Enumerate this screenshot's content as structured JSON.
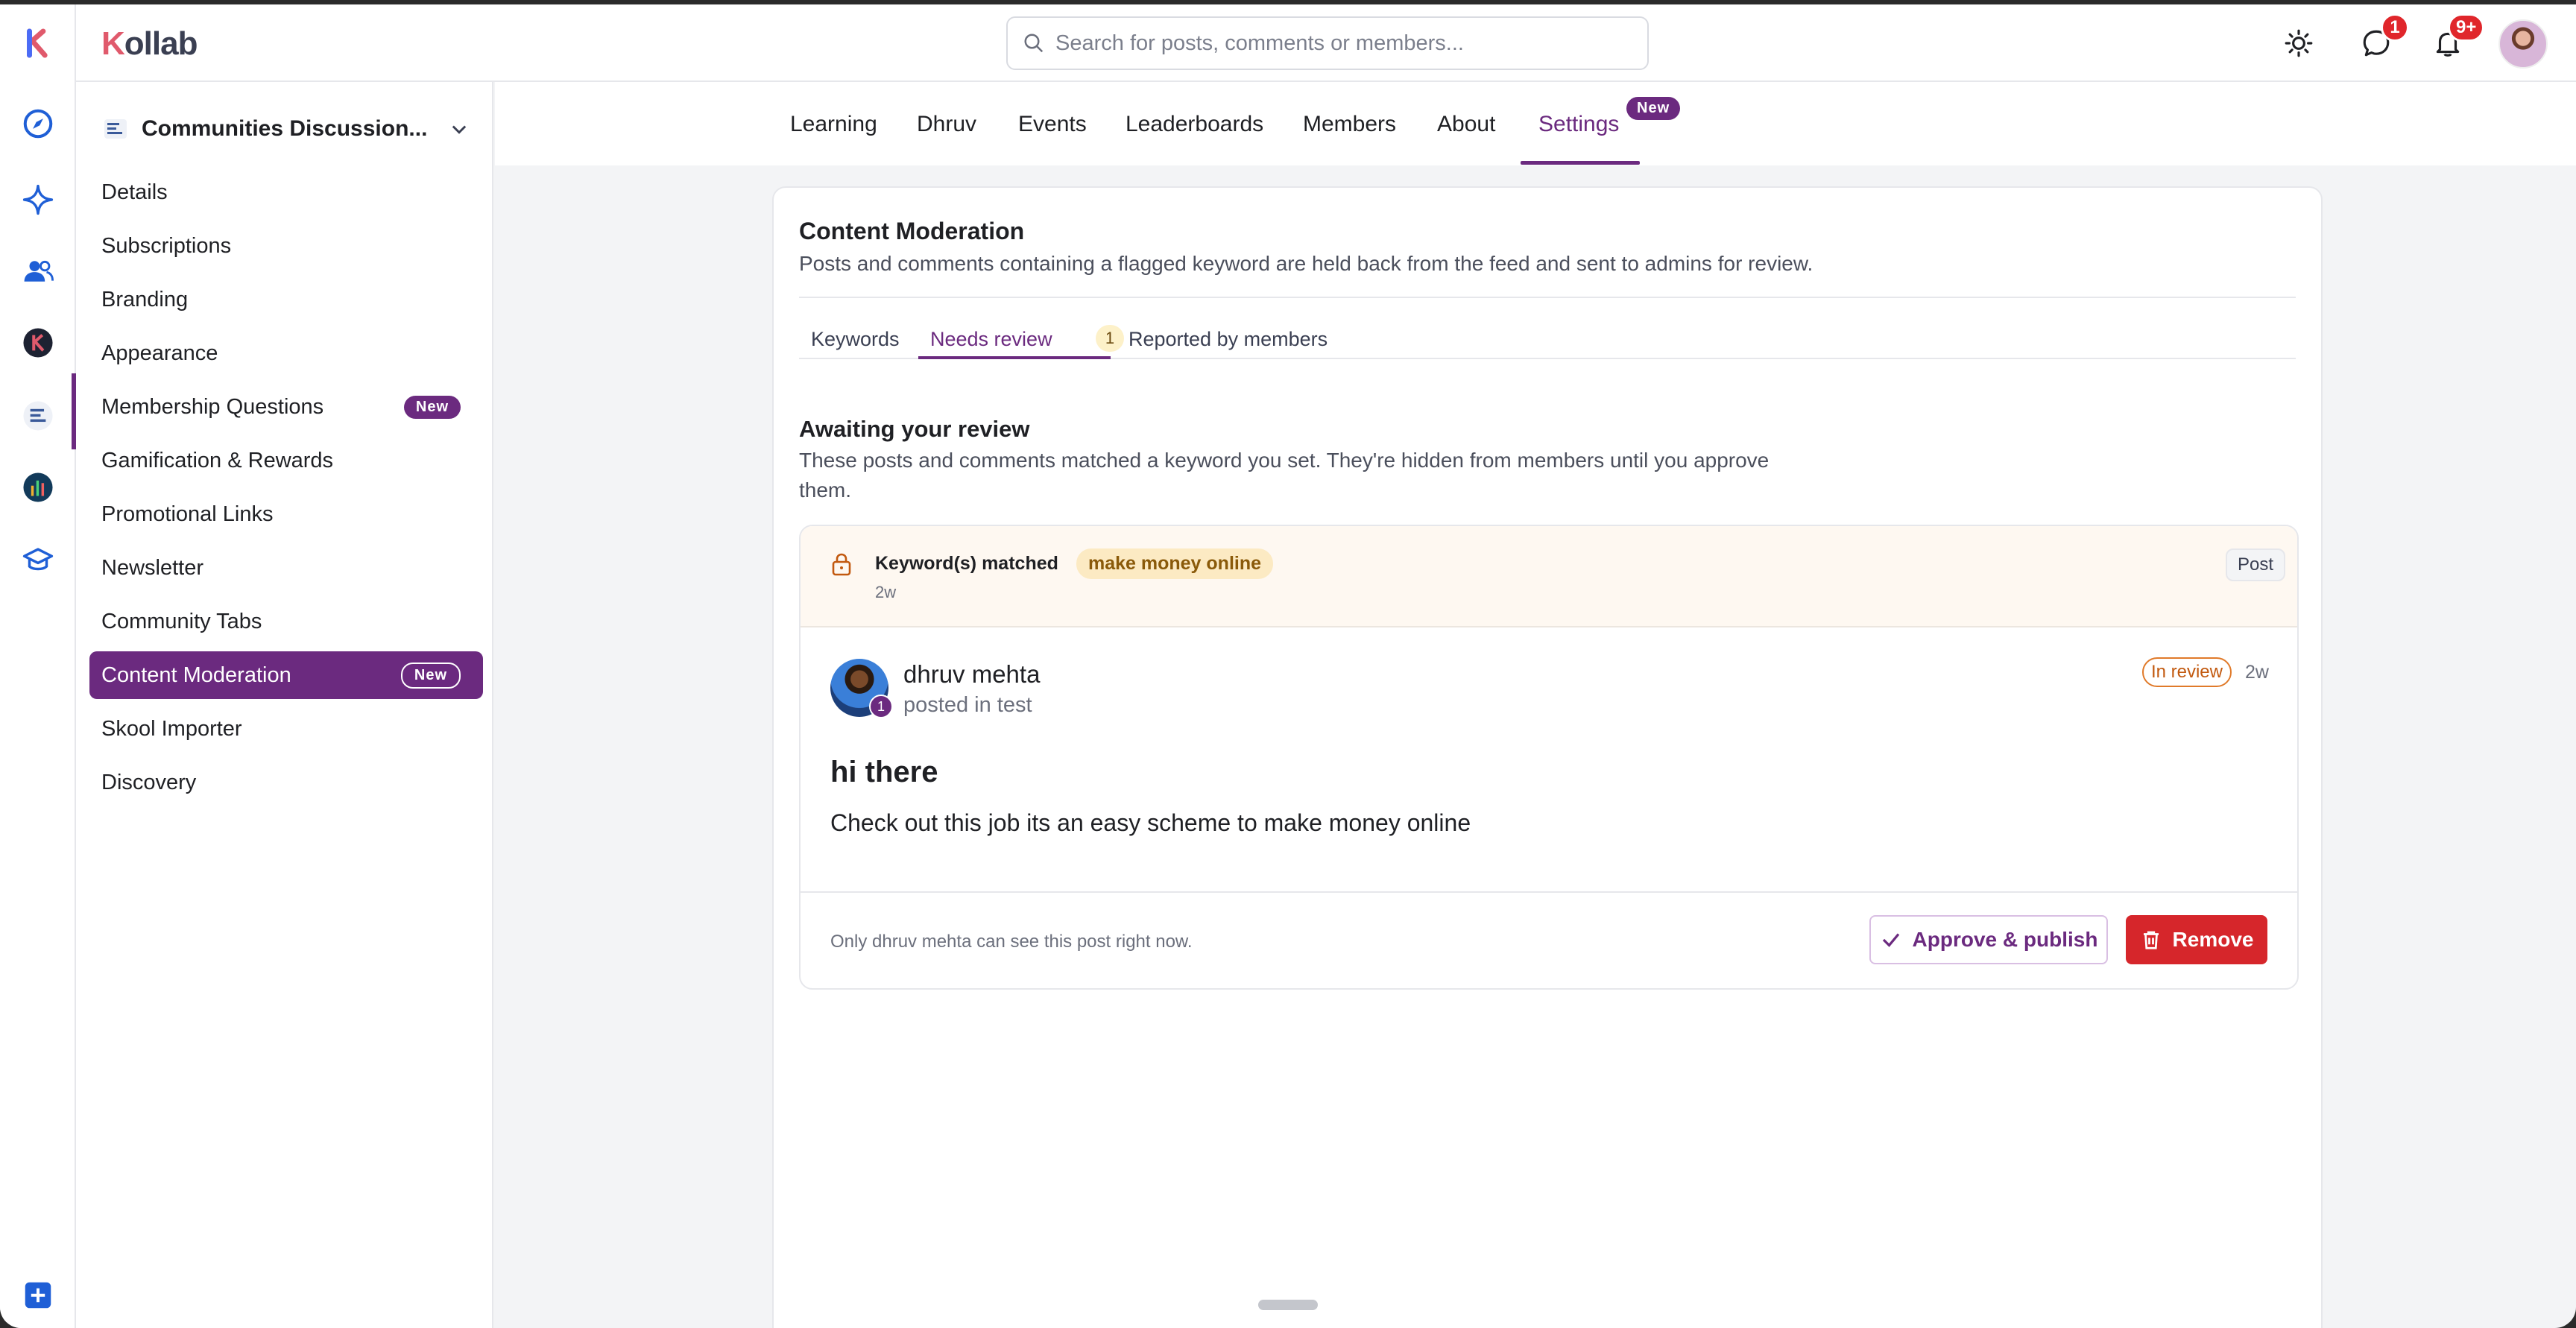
{
  "brand": {
    "logo_k": "K",
    "logo_rest": "ollab",
    "rail_logo": "K"
  },
  "search": {
    "placeholder": "Search for posts, comments or members..."
  },
  "header": {
    "chat_badge": "1",
    "notif_badge": "9+"
  },
  "sidebar": {
    "community_name": "Communities Discussion...",
    "items": [
      {
        "label": "Details"
      },
      {
        "label": "Subscriptions"
      },
      {
        "label": "Branding"
      },
      {
        "label": "Appearance"
      },
      {
        "label": "Membership Questions",
        "badge": "New"
      },
      {
        "label": "Gamification & Rewards"
      },
      {
        "label": "Promotional Links"
      },
      {
        "label": "Newsletter"
      },
      {
        "label": "Community Tabs"
      },
      {
        "label": "Content Moderation",
        "badge": "New",
        "active": true
      },
      {
        "label": "Skool Importer"
      },
      {
        "label": "Discovery"
      }
    ]
  },
  "tabs": {
    "items": [
      "Learning",
      "Dhruv",
      "Events",
      "Leaderboards",
      "Members",
      "About",
      "Settings"
    ],
    "active": "Settings",
    "settings_badge": "New"
  },
  "moderation": {
    "title": "Content Moderation",
    "description": "Posts and comments containing a flagged keyword are held back from the feed and sent to admins for review.",
    "subtabs": [
      "Keywords",
      "Needs review",
      "Reported by members"
    ],
    "needs_review_count": "1",
    "await_title": "Awaiting your review",
    "await_desc": "These posts and comments matched a keyword you set. They're hidden from members until you approve them."
  },
  "post": {
    "flag_label": "Keyword(s) matched",
    "keyword": "make money online",
    "flag_time": "2w",
    "type": "Post",
    "author": "dhruv mehta",
    "author_level": "1",
    "posted_in": "posted in test",
    "status": "In review",
    "time": "2w",
    "title": "hi there",
    "body": "Check out this job its an easy scheme to make money online",
    "footer_note": "Only dhruv mehta can see this post right now.",
    "approve_label": "Approve & publish",
    "remove_label": "Remove"
  },
  "colors": {
    "accent": "#6b2a7f",
    "danger": "#d6262b",
    "keyword_bg": "#fceac3"
  }
}
